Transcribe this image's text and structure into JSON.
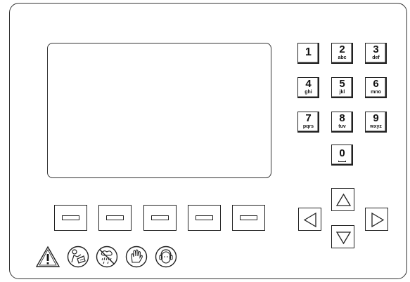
{
  "panel": {
    "display": {
      "content": ""
    },
    "keypad": {
      "keys": [
        {
          "digit": "1",
          "letters": ""
        },
        {
          "digit": "2",
          "letters": "abc"
        },
        {
          "digit": "3",
          "letters": "def"
        },
        {
          "digit": "4",
          "letters": "ghi"
        },
        {
          "digit": "5",
          "letters": "jkl"
        },
        {
          "digit": "6",
          "letters": "mno"
        },
        {
          "digit": "7",
          "letters": "pqrs"
        },
        {
          "digit": "8",
          "letters": "tuv"
        },
        {
          "digit": "9",
          "letters": "wxyz"
        },
        {
          "digit": "0",
          "letters": ""
        }
      ]
    },
    "softkeys": [
      "softkey-1",
      "softkey-2",
      "softkey-3",
      "softkey-4",
      "softkey-5"
    ],
    "navigation": [
      "arrow-up-icon",
      "arrow-left-icon",
      "arrow-right-icon",
      "arrow-down-icon"
    ],
    "safety_symbols": [
      "warning-triangle-icon",
      "read-manual-icon",
      "no-water-spray-icon",
      "wear-gloves-icon",
      "wear-ear-protection-icon"
    ]
  }
}
